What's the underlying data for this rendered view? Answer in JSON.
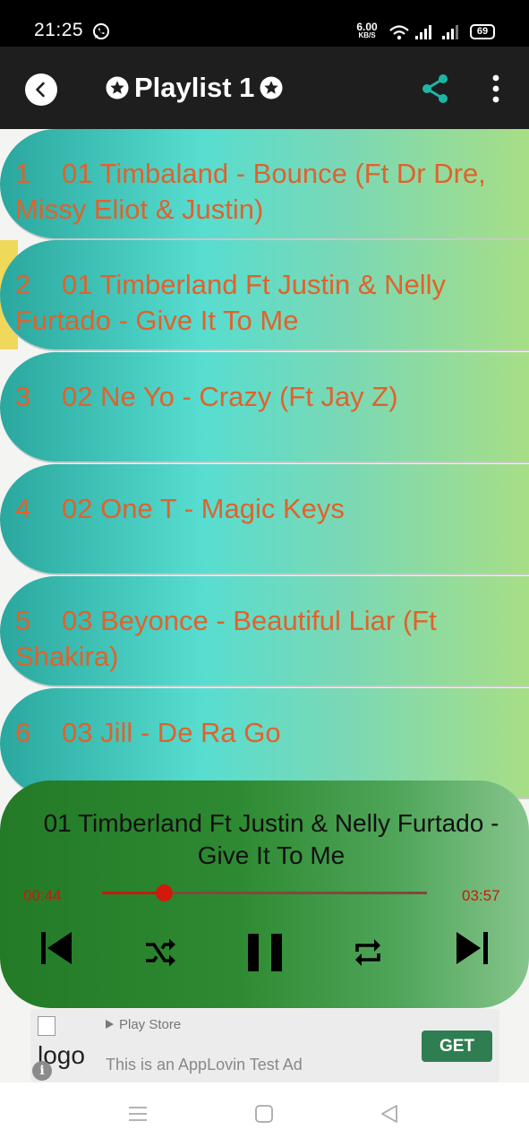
{
  "status_bar": {
    "time": "21:25",
    "net_speed_value": "6.00",
    "net_speed_unit": "KB/S",
    "battery": "69",
    "icons": [
      "whatsapp-icon",
      "wifi-icon",
      "signal-icon",
      "signal-icon",
      "battery-icon"
    ]
  },
  "app_bar": {
    "title": "Playlist 1",
    "icons": [
      "back-icon",
      "star-icon",
      "share-icon",
      "more-vert-icon"
    ],
    "accent_color": "#1fb5a6"
  },
  "playlist": {
    "items": [
      {
        "num": "1",
        "title": "01 Timbaland - Bounce (Ft Dr Dre, Missy Eliot & Justin)"
      },
      {
        "num": "2",
        "title": "01 Timberland Ft Justin & Nelly Furtado - Give It To Me"
      },
      {
        "num": "3",
        "title": "02 Ne Yo - Crazy (Ft Jay Z)"
      },
      {
        "num": "4",
        "title": "02 One T - Magic Keys"
      },
      {
        "num": "5",
        "title": "03 Beyonce - Beautiful Liar (Ft Shakira)"
      },
      {
        "num": "6",
        "title": "03 Jill - De Ra Go"
      }
    ],
    "text_color": "#e0622c"
  },
  "player": {
    "now_playing": "01 Timberland Ft Justin & Nelly Furtado - Give It To Me",
    "current_time": "00:44",
    "total_time": "03:57",
    "progress": 0.19,
    "time_color": "#c81a0d",
    "controls": [
      "skip-previous-icon",
      "shuffle-icon",
      "pause-icon",
      "repeat-icon",
      "skip-next-icon"
    ]
  },
  "ad": {
    "logo_alt": "logo",
    "store": "Play Store",
    "text": "This is an AppLovin Test Ad",
    "button": "GET",
    "button_color": "#2f7e52"
  },
  "nav_bar": {
    "icons": [
      "menu-icon",
      "home-square-icon",
      "back-triangle-icon"
    ]
  }
}
